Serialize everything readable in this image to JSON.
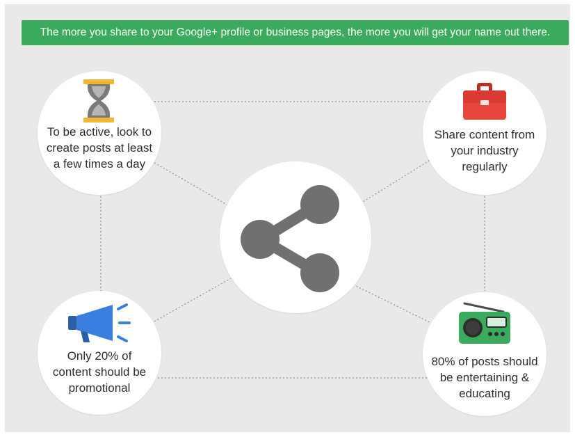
{
  "banner": {
    "text": "The more you share to your Google+ profile or business pages, the more you will get your name out there."
  },
  "nodes": [
    {
      "id": "top-left",
      "icon": "hourglass-icon",
      "text": "To be active, look to\ncreate posts at least\na few times a day"
    },
    {
      "id": "top-right",
      "icon": "briefcase-icon",
      "text": "Share content from\nyour industry\nregularly"
    },
    {
      "id": "bottom-left",
      "icon": "megaphone-icon",
      "text": "Only 20% of\ncontent should be\npromotional"
    },
    {
      "id": "bottom-right",
      "icon": "radio-icon",
      "text": "80% of posts should\nbe entertaining &\neducating"
    }
  ],
  "center": {
    "icon": "share-icon"
  },
  "colors": {
    "banner": "#3aab5c",
    "background": "#e9e9e9",
    "hourglass_gold": "#f2b632",
    "hourglass_sand": "#8a8a8a",
    "briefcase": "#e8453c",
    "megaphone": "#3a7fe0",
    "radio": "#3aab5c",
    "share_icon": "#707070"
  }
}
